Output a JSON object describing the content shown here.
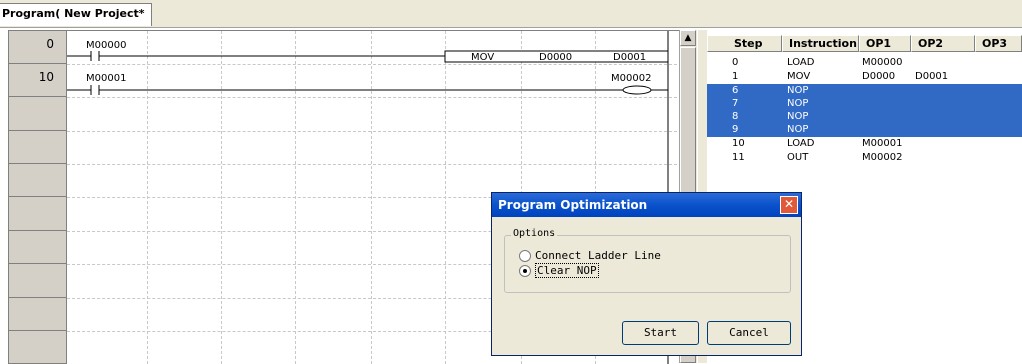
{
  "tab": {
    "title": "Program( New Project*"
  },
  "ladder": {
    "rows": [
      {
        "step": "0",
        "contact": "M00000",
        "instruction": "MOV",
        "operand1": "D0000",
        "operand2": "D0001"
      },
      {
        "step": "10",
        "contact": "M00001",
        "coil": "M00002"
      }
    ]
  },
  "list": {
    "headers": [
      "Step",
      "Instruction",
      "OP1",
      "OP2",
      "OP3"
    ],
    "rows": [
      {
        "step": "0",
        "instruction": "LOAD",
        "op1": "M00000",
        "op2": "",
        "selected": false
      },
      {
        "step": "1",
        "instruction": "MOV",
        "op1": "D0000",
        "op2": "D0001",
        "selected": false
      },
      {
        "step": "6",
        "instruction": "NOP",
        "op1": "",
        "op2": "",
        "selected": true
      },
      {
        "step": "7",
        "instruction": "NOP",
        "op1": "",
        "op2": "",
        "selected": true
      },
      {
        "step": "8",
        "instruction": "NOP",
        "op1": "",
        "op2": "",
        "selected": true
      },
      {
        "step": "9",
        "instruction": "NOP",
        "op1": "",
        "op2": "",
        "selected": true
      },
      {
        "step": "10",
        "instruction": "LOAD",
        "op1": "M00001",
        "op2": "",
        "selected": false
      },
      {
        "step": "11",
        "instruction": "OUT",
        "op1": "M00002",
        "op2": "",
        "selected": false
      }
    ]
  },
  "dialog": {
    "title": "Program Optimization",
    "group_label": "Options",
    "options": [
      {
        "label": "Connect Ladder Line",
        "checked": false
      },
      {
        "label": "Clear NOP",
        "checked": true
      }
    ],
    "start_label": "Start",
    "cancel_label": "Cancel",
    "close_icon": "close-icon"
  },
  "colors": {
    "selection": "#316ac5",
    "titlebar": "#0a52cc"
  }
}
